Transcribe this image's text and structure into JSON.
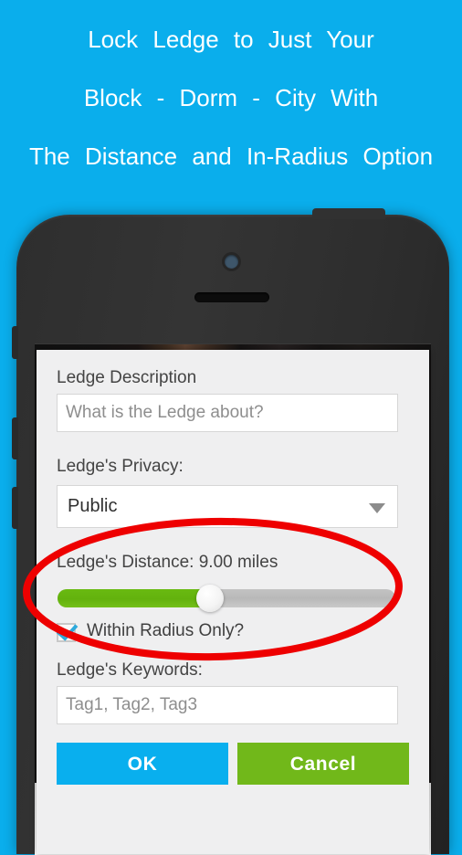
{
  "promo": {
    "lines": [
      "Lock Ledge to Just Your",
      "Block - Dorm - City With",
      "The Distance and In-Radius Option"
    ],
    "background_color": "#0aaeec",
    "text_color": "#ffffff"
  },
  "phone": {
    "camera_icon": "camera-icon",
    "speaker_icon": "speaker-grille-icon",
    "power_button": "power-button",
    "side_buttons": [
      "silent-switch",
      "volume-up",
      "volume-down"
    ]
  },
  "dialog": {
    "description": {
      "label": "Ledge Description",
      "placeholder": "What is the Ledge about?",
      "value": ""
    },
    "privacy": {
      "label": "Ledge's Privacy:",
      "selected": "Public",
      "dropdown_icon": "chevron-down-icon"
    },
    "distance": {
      "label": "Ledge's Distance: 9.00 miles",
      "value": 9.0,
      "unit": "miles",
      "percent": 45,
      "fill_color": "#63b20d",
      "track_color": "#bdbdbd"
    },
    "radius": {
      "label": "Within Radius Only?",
      "checked": true,
      "check_color": "#2eaadc"
    },
    "keywords": {
      "label": "Ledge's Keywords:",
      "placeholder": "Tag1, Tag2, Tag3",
      "value": ""
    },
    "buttons": {
      "ok_label": "OK",
      "ok_color": "#09afee",
      "cancel_label": "Cancel",
      "cancel_color": "#71b81a"
    }
  },
  "annotation": {
    "shape": "ellipse",
    "color": "#ee0000"
  }
}
